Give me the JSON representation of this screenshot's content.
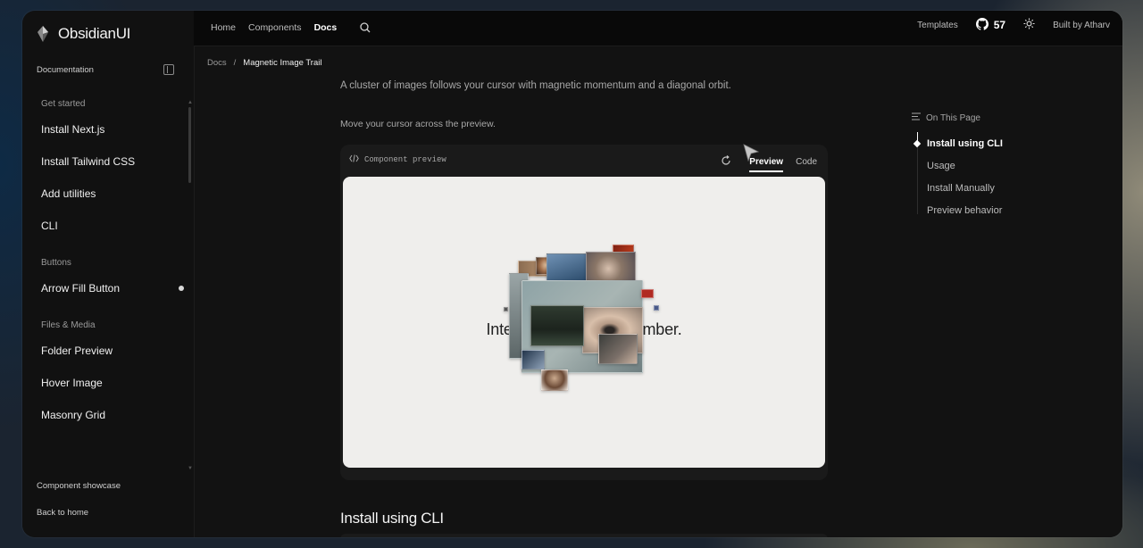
{
  "brand": {
    "name": "ObsidianUI"
  },
  "topnav": {
    "links": [
      "Home",
      "Components",
      "Docs"
    ],
    "active": "Docs",
    "right": {
      "templates": "Templates",
      "stars": "57",
      "built_by": "Built by Atharv"
    }
  },
  "sidebar": {
    "header": "Documentation",
    "groups": [
      {
        "title": "Get started",
        "items": [
          "Install Next.js",
          "Install Tailwind CSS",
          "Add utilities",
          "CLI"
        ]
      },
      {
        "title": "Buttons",
        "items": [
          "Arrow Fill Button"
        ]
      },
      {
        "title": "Files & Media",
        "items": [
          "Folder Preview",
          "Hover Image",
          "Masonry Grid"
        ]
      }
    ],
    "footer": [
      "Component showcase",
      "Back to home"
    ]
  },
  "breadcrumb": {
    "root": "Docs",
    "separator": "/",
    "current": "Magnetic Image Trail"
  },
  "main": {
    "description": "A cluster of images follows your cursor with magnetic momentum and a diagonal orbit.",
    "hint": "Move your cursor across the preview.",
    "preview": {
      "label": "Component preview",
      "tabs": [
        "Preview",
        "Code"
      ],
      "active_tab": "Preview",
      "canvas_text_left": "Inter",
      "canvas_text_right": "mber."
    },
    "section_title": "Install using CLI"
  },
  "toc": {
    "title": "On This Page",
    "items": [
      "Install using CLI",
      "Usage",
      "Install Manually",
      "Preview behavior"
    ],
    "active": "Install using CLI"
  },
  "colors": {
    "frame_bg": "#111111",
    "canvas_bg": "#efeeec",
    "accent": "#ffffff"
  }
}
